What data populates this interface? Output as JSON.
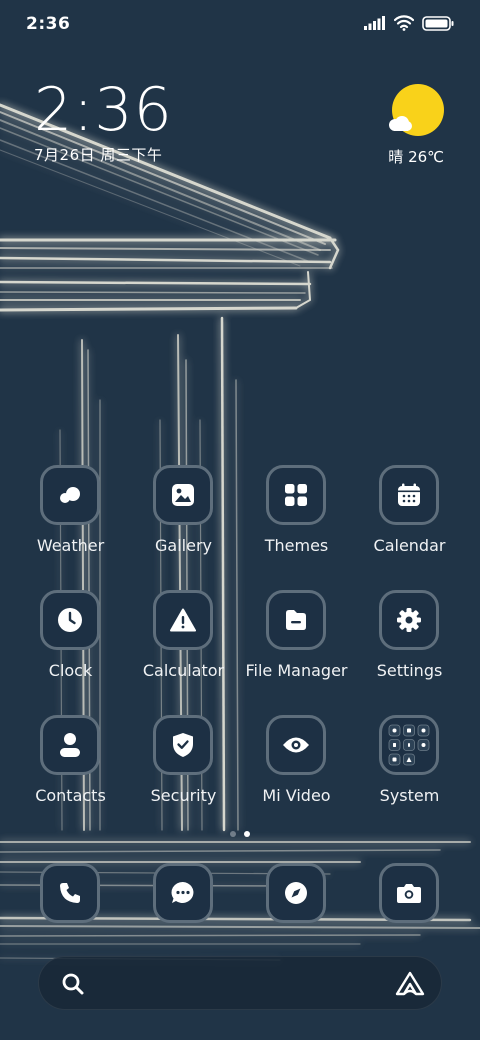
{
  "status_bar": {
    "time": "2:36",
    "icons": [
      "signal-icon",
      "wifi-icon",
      "battery-icon"
    ]
  },
  "clock_widget": {
    "time": "2:36",
    "date": "7月26日 周三下午"
  },
  "weather_widget": {
    "condition_icon": "sunny-cloud-icon",
    "text": "晴 26℃"
  },
  "apps": [
    {
      "label": "Weather",
      "icon": "weather-icon"
    },
    {
      "label": "Gallery",
      "icon": "gallery-icon"
    },
    {
      "label": "Themes",
      "icon": "themes-icon"
    },
    {
      "label": "Calendar",
      "icon": "calendar-icon"
    },
    {
      "label": "Clock",
      "icon": "clock-icon"
    },
    {
      "label": "Calculator",
      "icon": "calculator-icon"
    },
    {
      "label": "File Manager",
      "icon": "folder-icon"
    },
    {
      "label": "Settings",
      "icon": "gear-icon"
    },
    {
      "label": "Contacts",
      "icon": "person-icon"
    },
    {
      "label": "Security",
      "icon": "shield-icon"
    },
    {
      "label": "Mi Video",
      "icon": "eye-icon"
    },
    {
      "label": "System",
      "icon": "folder-grid-icon"
    }
  ],
  "page_indicator": {
    "pages": 2,
    "active": 2
  },
  "dock": [
    {
      "app": "Phone",
      "icon": "phone-icon"
    },
    {
      "app": "Messages",
      "icon": "chat-icon"
    },
    {
      "app": "Browser",
      "icon": "compass-icon"
    },
    {
      "app": "Camera",
      "icon": "camera-icon"
    }
  ],
  "search_bar": {
    "left_icon": "search-icon",
    "right_icon": "assistant-icon"
  },
  "colors": {
    "background": "#203447",
    "icon_bg": "#1d3044",
    "icon_border": "#5e6e7c",
    "sun": "#f9d21a",
    "wallpaper_strokes": "#e8e6da"
  }
}
